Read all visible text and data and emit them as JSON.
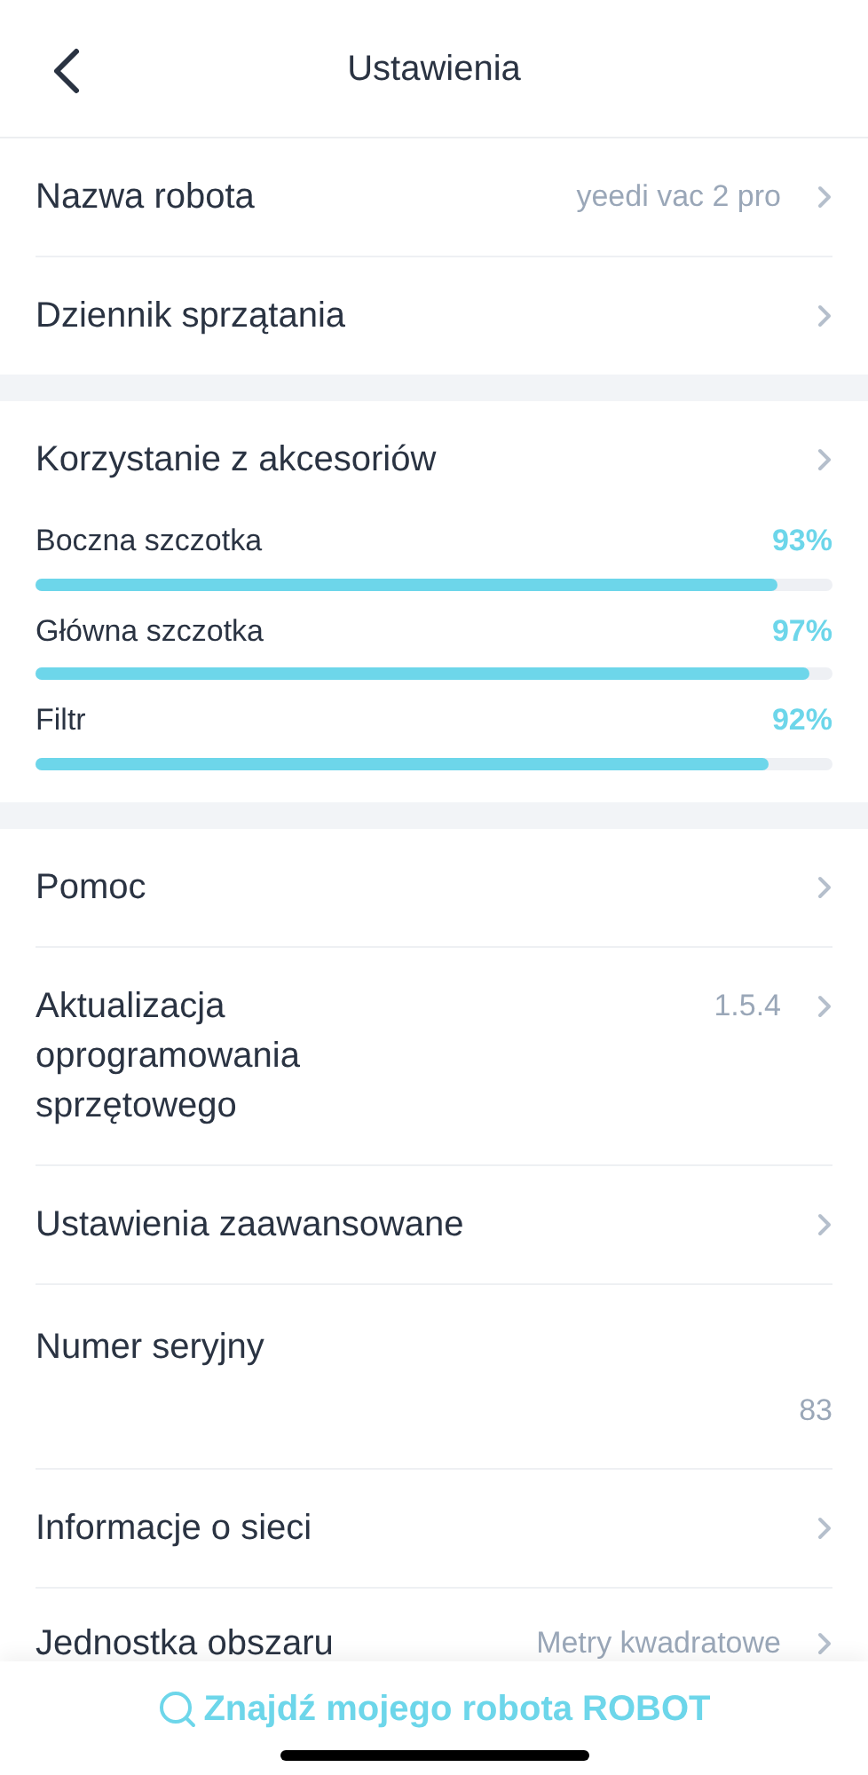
{
  "header": {
    "title": "Ustawienia"
  },
  "sections": [
    {
      "rows": [
        {
          "kind": "link",
          "label": "Nazwa robota",
          "value": "yeedi vac 2 pro"
        },
        {
          "kind": "link",
          "label": "Dziennik sprzątania"
        }
      ]
    },
    {
      "rows": [
        {
          "kind": "link",
          "label": "Korzystanie z akcesoriów"
        }
      ],
      "meters": [
        {
          "name": "Boczna szczotka",
          "reading": "93%",
          "level": 0.93
        },
        {
          "name": "Główna szczotka",
          "reading": "97%",
          "level": 0.97
        },
        {
          "name": "Filtr",
          "reading": "92%",
          "level": 0.92
        }
      ]
    },
    {
      "rows": [
        {
          "kind": "link",
          "label": "Pomoc"
        },
        {
          "kind": "link",
          "label": "Aktualizacja oprogramowania sprzętowego",
          "value": "1.5.4"
        },
        {
          "kind": "link",
          "label": "Ustawienia zaawansowane"
        },
        {
          "kind": "info",
          "label": "Numer seryjny",
          "value": "83"
        },
        {
          "kind": "link",
          "label": "Informacje o sieci"
        },
        {
          "kind": "link",
          "label": "Jednostka obszaru",
          "value": "Metry kwadratowe"
        }
      ]
    }
  ],
  "footer": {
    "button": "Znajdź mojego robota ROBOT"
  }
}
